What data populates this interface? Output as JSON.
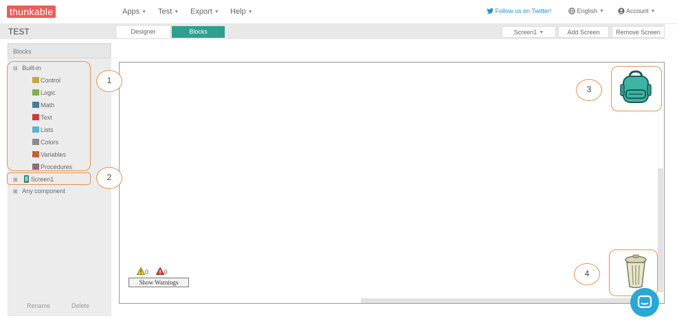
{
  "brand": {
    "logo_text": "thunkable",
    "logo_color": "#ef5b5b"
  },
  "nav": {
    "menus": [
      {
        "label": "Apps"
      },
      {
        "label": "Test"
      },
      {
        "label": "Export"
      },
      {
        "label": "Help"
      }
    ],
    "twitter_label": "Follow us on Twitter!",
    "language_label": "English",
    "account_label": "Account"
  },
  "toolbar": {
    "project_name": "TEST",
    "designer_label": "Designer",
    "blocks_label": "Blocks",
    "screen_select": "Screen1",
    "add_screen_label": "Add Screen",
    "remove_screen_label": "Remove Screen",
    "accent_color": "#2e9f91"
  },
  "sidebar": {
    "header": "Blocks",
    "builtin_label": "Built-in",
    "builtin_items": [
      {
        "label": "Control",
        "color": "#c8a93e"
      },
      {
        "label": "Logic",
        "color": "#7fb04a"
      },
      {
        "label": "Math",
        "color": "#3d7f95"
      },
      {
        "label": "Text",
        "color": "#cc3b3b"
      },
      {
        "label": "Lists",
        "color": "#53b6d8"
      },
      {
        "label": "Colors",
        "color": "#8a8a8a"
      },
      {
        "label": "Variables",
        "color": "#d2782f"
      },
      {
        "label": "Procedures",
        "color": "#8f6a7a"
      }
    ],
    "screen_label": "Screen1",
    "any_component_label": "Any component",
    "rename_label": "Rename",
    "delete_label": "Delete"
  },
  "workspace": {
    "warnings_count": "0",
    "errors_count": "0",
    "show_warnings_label": "Show Warnings"
  },
  "annotations": {
    "callout_1": "1",
    "callout_2": "2",
    "callout_3": "3",
    "callout_4": "4",
    "highlight_color": "#e29150"
  }
}
